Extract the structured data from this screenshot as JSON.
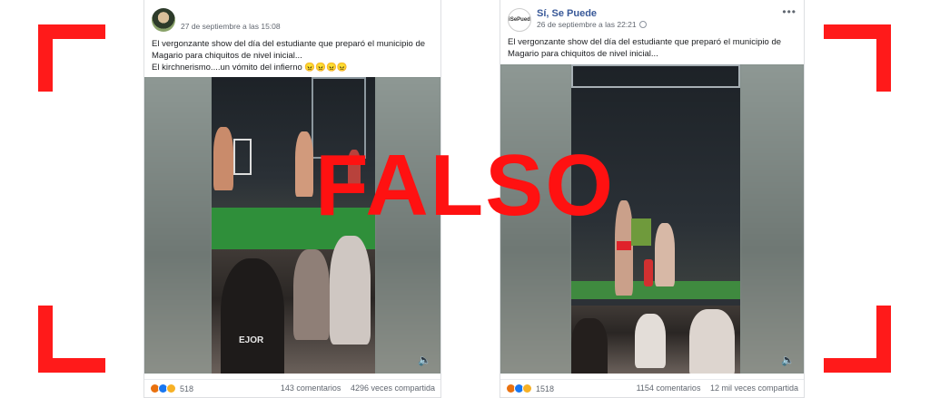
{
  "stamp": {
    "text": "FALSO",
    "color": "#ff1111"
  },
  "accent_color": "#ff1a1a",
  "posts": [
    {
      "page_name": "",
      "timestamp": "27 de septiembre a las 15:08",
      "text_lines": [
        "El vergonzante show del día del estudiante que preparó el municipio de",
        "Magario para chiquitos de nivel inicial...",
        "El kirchnerismo....un vómito del infierno 😠😠😠😠"
      ],
      "reaction_count": "518",
      "comments": "143 comentarios",
      "shares": "4296 veces compartida",
      "video_overlay_text": "EJOR"
    },
    {
      "page_name": "Sí, Se Puede",
      "avatar_text": "siSePuede",
      "timestamp": "26 de septiembre a las 22:21",
      "text_lines": [
        "El vergonzante show del día del estudiante que preparó el municipio de",
        "Magario para chiquitos de nivel inicial..."
      ],
      "reaction_count": "1518",
      "comments": "1154 comentarios",
      "shares": "12 mil veces compartida"
    }
  ]
}
